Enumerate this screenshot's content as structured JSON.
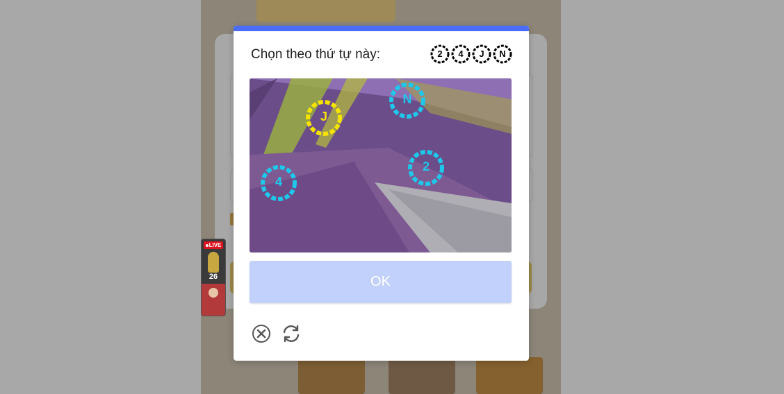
{
  "captcha": {
    "prompt": "Chọn theo thứ tự này:",
    "sequence": [
      {
        "glyph": "2",
        "icon": "wreath-icon"
      },
      {
        "glyph": "4",
        "icon": "wreath-icon"
      },
      {
        "glyph": "J",
        "icon": "wreath-icon"
      },
      {
        "glyph": "N",
        "icon": "wreath-icon"
      }
    ],
    "targets": [
      {
        "glyph": "J",
        "color": "#f5e400"
      },
      {
        "glyph": "N",
        "color": "#1ec8ea"
      },
      {
        "glyph": "2",
        "color": "#1ec8ea"
      },
      {
        "glyph": "4",
        "color": "#1ec8ea"
      }
    ],
    "ok_label": "OK",
    "accent_color": "#4a6cf7",
    "ok_button_color": "#c2d1fb",
    "close_icon": "close-circle-icon",
    "refresh_icon": "refresh-icon"
  },
  "live_widget": {
    "badge": "LIVE",
    "number": "26"
  }
}
